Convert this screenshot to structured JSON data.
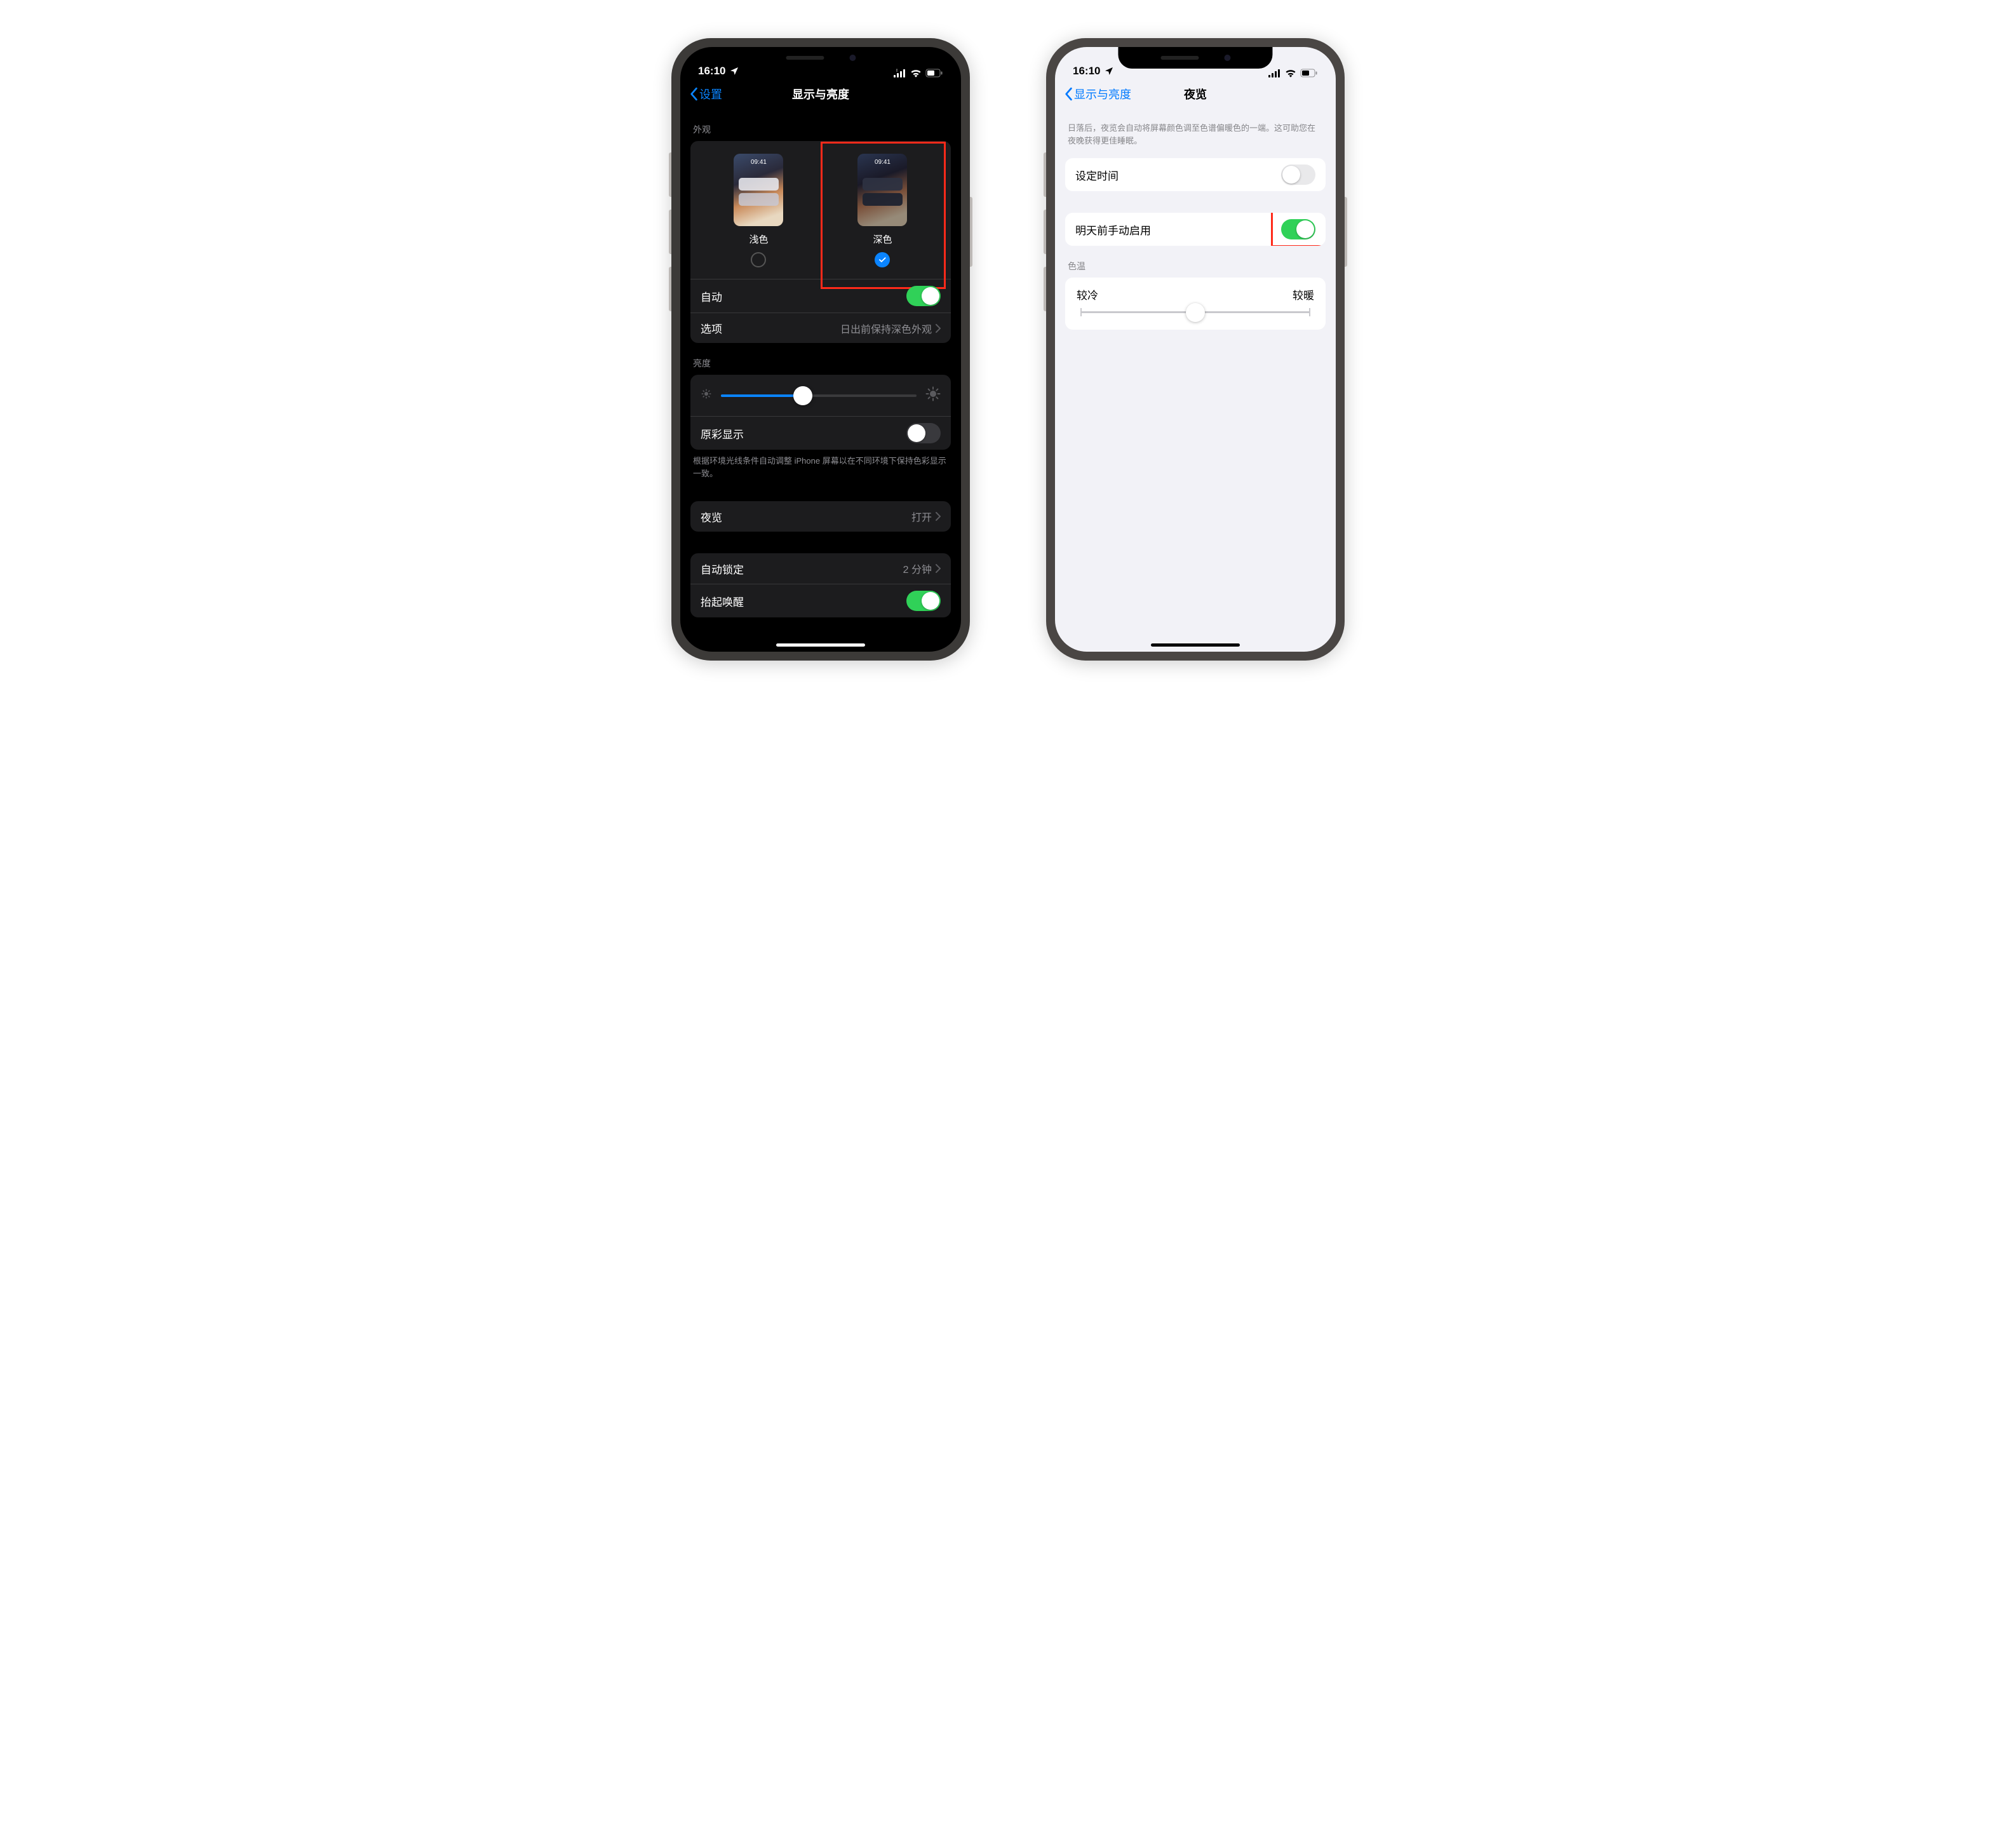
{
  "statusBar": {
    "time": "16:10"
  },
  "phone1": {
    "nav": {
      "back": "设置",
      "title": "显示与亮度"
    },
    "appearance": {
      "header": "外观",
      "light": {
        "label": "浅色",
        "previewTime": "09:41",
        "selected": false
      },
      "dark": {
        "label": "深色",
        "previewTime": "09:41",
        "selected": true
      },
      "autoLabel": "自动",
      "autoOn": true,
      "optionsLabel": "选项",
      "optionsDetail": "日出前保持深色外观"
    },
    "brightness": {
      "header": "亮度",
      "valuePercent": 42,
      "trueToneLabel": "原彩显示",
      "trueToneOn": false,
      "footer": "根据环境光线条件自动调整 iPhone 屏幕以在不同环境下保持色彩显示一致。"
    },
    "nightShift": {
      "label": "夜览",
      "detail": "打开"
    },
    "autoLock": {
      "label": "自动锁定",
      "detail": "2 分钟"
    },
    "raiseToWake": {
      "label": "抬起唤醒",
      "on": true
    }
  },
  "phone2": {
    "nav": {
      "back": "显示与亮度",
      "title": "夜览"
    },
    "intro": "日落后，夜览会自动将屏幕颜色调至色谱偏暖色的一端。这可助您在夜晚获得更佳睡眠。",
    "scheduled": {
      "label": "设定时间",
      "on": false
    },
    "manual": {
      "label": "明天前手动启用",
      "on": true
    },
    "temp": {
      "header": "色温",
      "coldLabel": "较冷",
      "warmLabel": "较暖",
      "valuePercent": 50
    }
  }
}
